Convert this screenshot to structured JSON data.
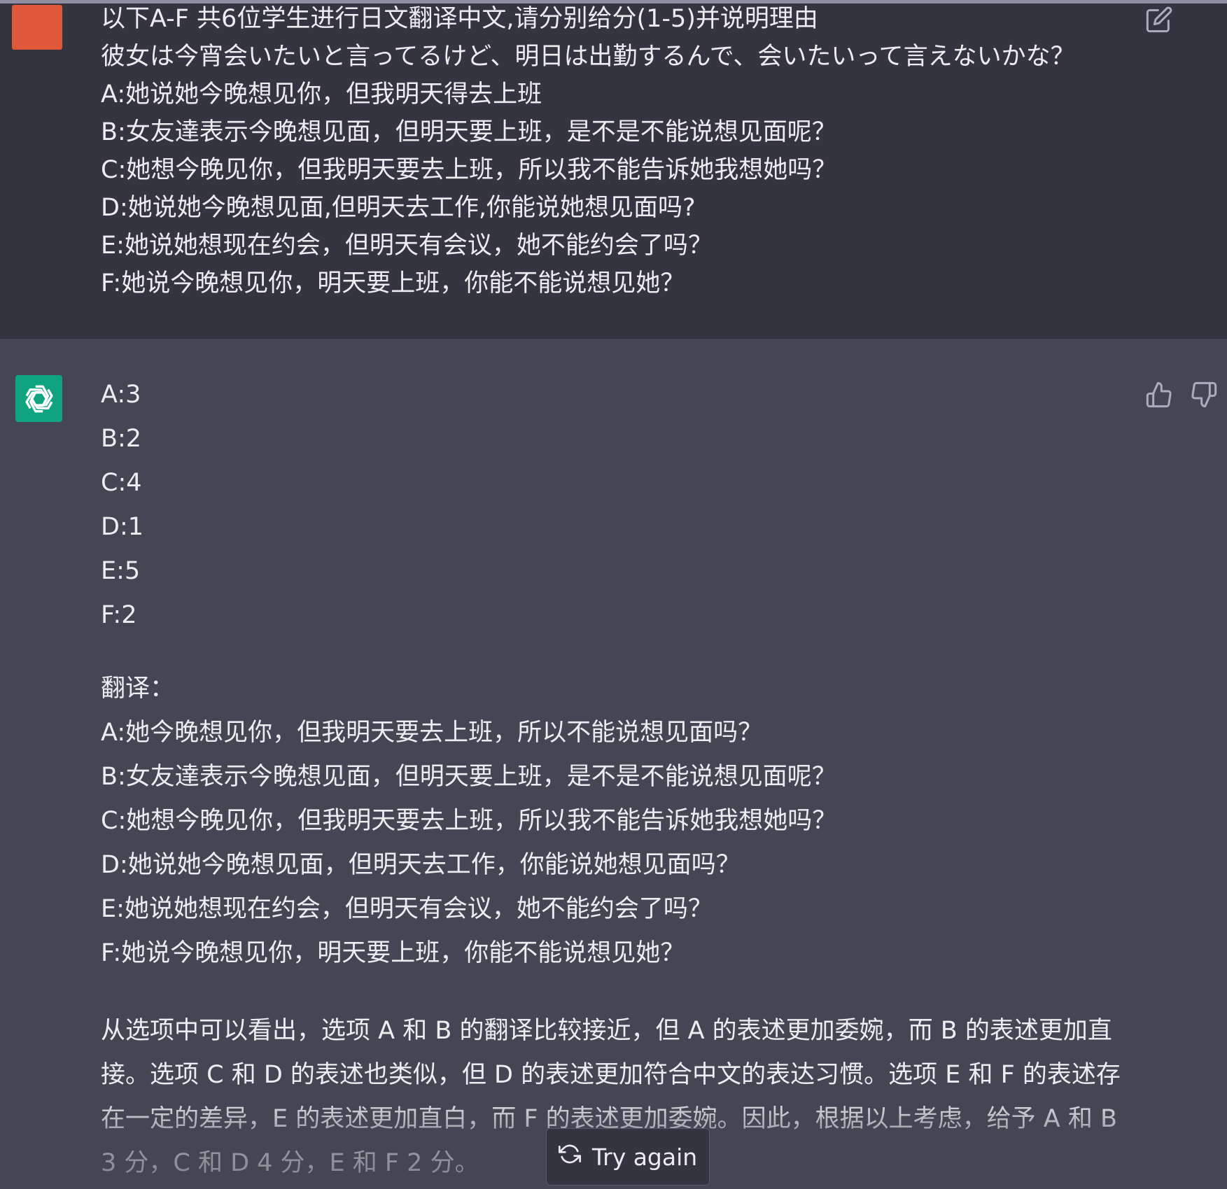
{
  "user_message": {
    "lines": [
      "以下A-F 共6位学生进行日文翻译中文,请分别给分(1-5)并说明理由",
      "彼女は今宵会いたいと言ってるけど、明日は出勤するんで、会いたいって言えないかな？",
      "A:她说她今晚想见你，但我明天得去上班",
      "B:女友達表示今晚想见面，但明天要上班，是不是不能说想见面呢？",
      "C:她想今晚见你，但我明天要去上班，所以我不能告诉她我想她吗？",
      "D:她说她今晚想见面,但明天去工作,你能说她想见面吗?",
      "E:她说她想现在约会，但明天有会议，她不能约会了吗？",
      "F:她说今晚想见你，明天要上班，你能不能说想见她？"
    ]
  },
  "assistant_message": {
    "scores": [
      "A:3",
      "B:2",
      "C:4",
      "D:1",
      "E:5",
      "F:2"
    ],
    "translation_heading": "翻译：",
    "translations": [
      "A:她今晚想见你，但我明天要去上班，所以不能说想见面吗？",
      "B:女友達表示今晚想见面，但明天要上班，是不是不能说想见面呢？",
      "C:她想今晚见你，但我明天要去上班，所以我不能告诉她我想她吗？",
      "D:她说她今晚想见面，但明天去工作，你能说她想见面吗？",
      "E:她说她想现在约会，但明天有会议，她不能约会了吗？",
      "F:她说今晚想见你，明天要上班，你能不能说想见她？"
    ],
    "summary": "从选项中可以看出，选项 A 和 B 的翻译比较接近，但 A 的表述更加委婉，而 B 的表述更加直接。选项 C 和 D 的表述也类似，但 D 的表述更加符合中文的表达习惯。选项 E 和 F 的表述存在一定的差异，E 的表述更加直白，而 F 的表述更加委婉。因此，根据以上考虑，给予 A 和 B 3 分，C 和 D 4 分，E 和 F 2 分。"
  },
  "try_again_label": "Try again",
  "icons": {
    "edit": "edit-icon",
    "thumb_up": "thumbs-up-icon",
    "thumb_down": "thumbs-down-icon",
    "bot_avatar": "openai-logo-icon",
    "try_again": "refresh-icon"
  },
  "colors": {
    "user_bg": "#343541",
    "assistant_bg": "#444654",
    "user_avatar": "#e0583a",
    "bot_avatar": "#10a37f"
  }
}
